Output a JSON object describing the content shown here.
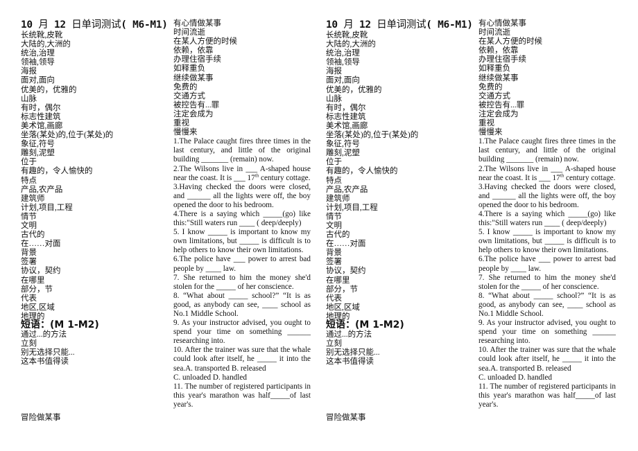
{
  "document": {
    "title_num1": "10",
    "title_month": "月",
    "title_num2": "12",
    "title_rest": "日单词测试",
    "title_range": "( M6-M1)",
    "vocab_col1": [
      "长统靴,皮靴",
      "大陆的,大洲的",
      "统治,治理",
      "领袖,领导",
      "海报",
      "面对,面向",
      "优美的，优雅的",
      "山脉",
      "有时，偶尔",
      "标志性建筑",
      "美术馆,画廊",
      "坐落(某处)的,位于(某处)的",
      "象征,符号",
      "雕刻,泥塑",
      "位于",
      "有趣的，令人愉快的",
      "特点",
      "产品,农产品",
      "建筑师",
      "计划,项目,工程",
      "情节",
      "文明",
      "古代的",
      "在……对面",
      "背景",
      "签署",
      "协议，契约",
      "在哪里",
      "部分，节",
      "代表",
      "地区,区域",
      "地理的"
    ],
    "phrase_title": "短语：(M 1-M2)",
    "phrases": [
      "通过...的方法",
      "立刻",
      "别无选择只能...",
      "这本书值得读"
    ],
    "bottom_item": "冒险做某事",
    "vocab_col2": [
      "有心情做某事",
      "时间流逝",
      "在某人方便的时候",
      "依赖，依靠",
      "办理住宿手续",
      "如释重负",
      "继续做某事",
      "免费的",
      "交通方式",
      "被控告有...罪",
      "注定会成为",
      "重视",
      "慢慢来"
    ],
    "questions": [
      "1.The Palace caught fires three times in the last century, and little of the original building _______ (remain) now.",
      "2.The Wilsons live in ___ A-shaped house near the coast. It is ___ 17",
      "th",
      " century cottage.",
      "3.Having checked the doors were closed, and ______ all the lights were off, the boy opened the door to his bedroom.",
      "4.There is a saying which _____(go) like this:\"Still waters run ____ ( deep/deeply)",
      "5. I know _____ is important to know my own limitations, but _____ is difficult is to help others to know their own limitations.",
      "6.The police have ___ power to arrest bad people by ____ law.",
      "7. She returned to him the money she'd stolen for the _____ of her conscience.",
      "8. “What about _____ school?” “It is as good, as anybody can see, ____ school as No.1 Middle School.",
      "9. As your instructor advised, you ought to spend your time on something ______ researching into.",
      "10. After the trainer was sure that the whale could look after itself, he _____ it into the sea.A. transported     B. released",
      "C. unloaded        D. handled",
      "11. The number of registered participants in this year's marathon was half_____of last year's."
    ]
  }
}
